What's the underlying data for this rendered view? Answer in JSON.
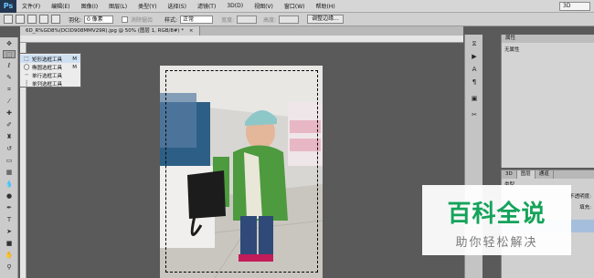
{
  "app": {
    "logo": "Ps",
    "menu": [
      "文件(F)",
      "编辑(E)",
      "图像(I)",
      "图层(L)",
      "类型(Y)",
      "选择(S)",
      "滤镜(T)",
      "3D(D)",
      "视图(V)",
      "窗口(W)",
      "帮助(H)"
    ],
    "workspace": "3D"
  },
  "options": {
    "feather_label": "羽化:",
    "feather_value": "0 像素",
    "antialias_label": "消除锯齿",
    "style_label": "样式:",
    "style_value": "正常",
    "width_label": "宽度:",
    "height_label": "高度:",
    "refine_edge": "调整边缘..."
  },
  "document": {
    "tab_title": "6D_R%GD8%(DCID908MMV29R).jpg @ 50% (图层 1, RGB/8#) *",
    "close_glyph": "×"
  },
  "flyout": {
    "items": [
      {
        "label": "矩形选框工具",
        "shortcut": "M",
        "icon": "rect-marquee-icon"
      },
      {
        "label": "椭圆选框工具",
        "shortcut": "M",
        "icon": "ellipse-marquee-icon"
      },
      {
        "label": "单行选框工具",
        "shortcut": "",
        "icon": "single-row-icon"
      },
      {
        "label": "单列选框工具",
        "shortcut": "",
        "icon": "single-column-icon"
      }
    ]
  },
  "panels": {
    "properties_title": "属性",
    "properties_text": "无属性",
    "layers_tabs": [
      "3D",
      "图层",
      "通道"
    ],
    "layer_kind": "类型",
    "opacity_label": "不透明度:",
    "fill_label": "填充:"
  },
  "watermark": {
    "title": "百科全说",
    "subtitle": "助你轻松解决"
  }
}
